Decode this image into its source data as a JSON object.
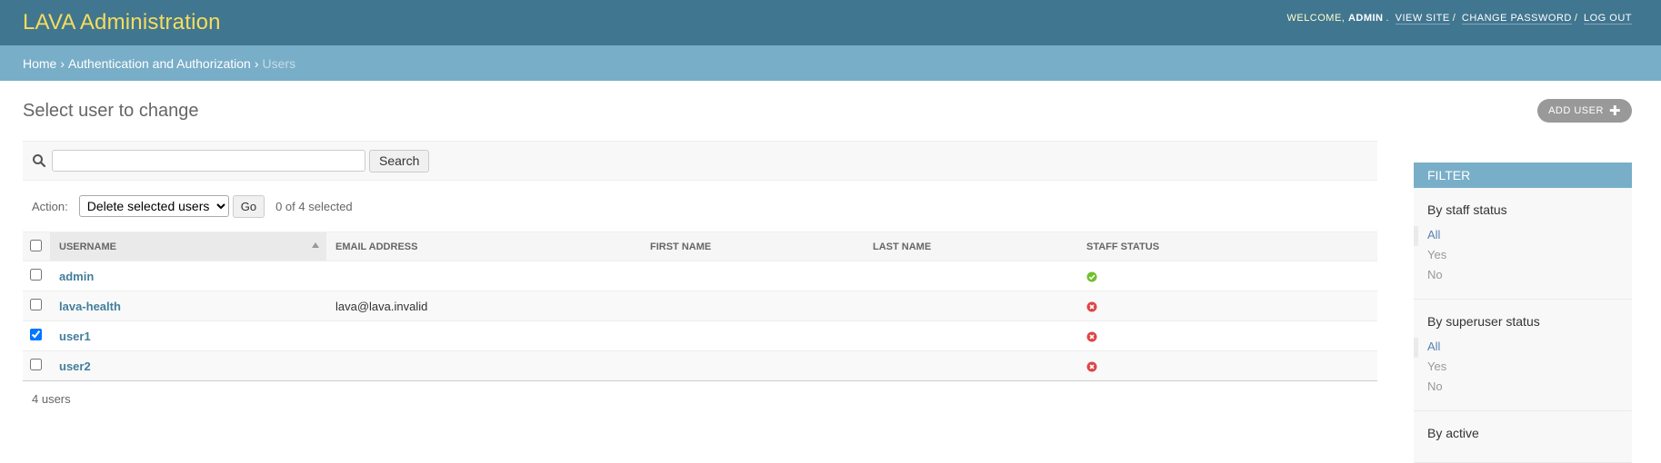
{
  "header": {
    "branding": "LAVA Administration",
    "welcome": "WELCOME,",
    "username": "ADMIN",
    "view_site": "VIEW SITE",
    "change_password": "CHANGE PASSWORD",
    "log_out": "LOG OUT"
  },
  "breadcrumbs": {
    "home": "Home",
    "app": "Authentication and Authorization",
    "current": "Users"
  },
  "page": {
    "title": "Select user to change",
    "add_user": "ADD USER"
  },
  "search": {
    "value": "",
    "button": "Search"
  },
  "actions": {
    "label": "Action:",
    "selected_option": "Delete selected users",
    "go": "Go",
    "counter": "0 of 4 selected"
  },
  "table": {
    "columns": [
      "USERNAME",
      "EMAIL ADDRESS",
      "FIRST NAME",
      "LAST NAME",
      "STAFF STATUS"
    ],
    "rows": [
      {
        "username": "admin",
        "email": "",
        "first_name": "",
        "last_name": "",
        "staff": true,
        "checked": false
      },
      {
        "username": "lava-health",
        "email": "lava@lava.invalid",
        "first_name": "",
        "last_name": "",
        "staff": false,
        "checked": false
      },
      {
        "username": "user1",
        "email": "",
        "first_name": "",
        "last_name": "",
        "staff": false,
        "checked": true
      },
      {
        "username": "user2",
        "email": "",
        "first_name": "",
        "last_name": "",
        "staff": false,
        "checked": false
      }
    ]
  },
  "paginator": "4 users",
  "filter": {
    "title": "FILTER",
    "groups": [
      {
        "title": "By staff status",
        "options": [
          "All",
          "Yes",
          "No"
        ]
      },
      {
        "title": "By superuser status",
        "options": [
          "All",
          "Yes",
          "No"
        ]
      },
      {
        "title": "By active",
        "options": []
      }
    ]
  },
  "colors": {
    "header_bg": "#417690",
    "branding": "#f5dd5d",
    "breadcrumbs_bg": "#79aec8",
    "link": "#447e9b",
    "yes_icon": "#70bf2b",
    "no_icon": "#dd4646"
  }
}
